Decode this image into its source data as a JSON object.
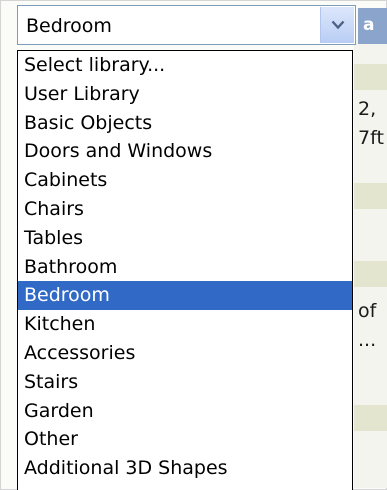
{
  "combo": {
    "value": "Bedroom",
    "dropdown_icon": "chevron-down-icon"
  },
  "side_button": {
    "label": "a"
  },
  "background_text": {
    "line1": "2,",
    "line2": "7ft",
    "line3": "of",
    "line4": "..."
  },
  "dropdown": {
    "selected_index": 8,
    "items": [
      {
        "label": "Select library..."
      },
      {
        "label": "User Library"
      },
      {
        "label": "Basic Objects"
      },
      {
        "label": "Doors and Windows"
      },
      {
        "label": "Cabinets"
      },
      {
        "label": "Chairs"
      },
      {
        "label": "Tables"
      },
      {
        "label": "Bathroom"
      },
      {
        "label": "Bedroom"
      },
      {
        "label": "Kitchen"
      },
      {
        "label": "Accessories"
      },
      {
        "label": "Stairs"
      },
      {
        "label": "Garden"
      },
      {
        "label": "Other"
      },
      {
        "label": "Additional 3D Shapes"
      }
    ]
  }
}
